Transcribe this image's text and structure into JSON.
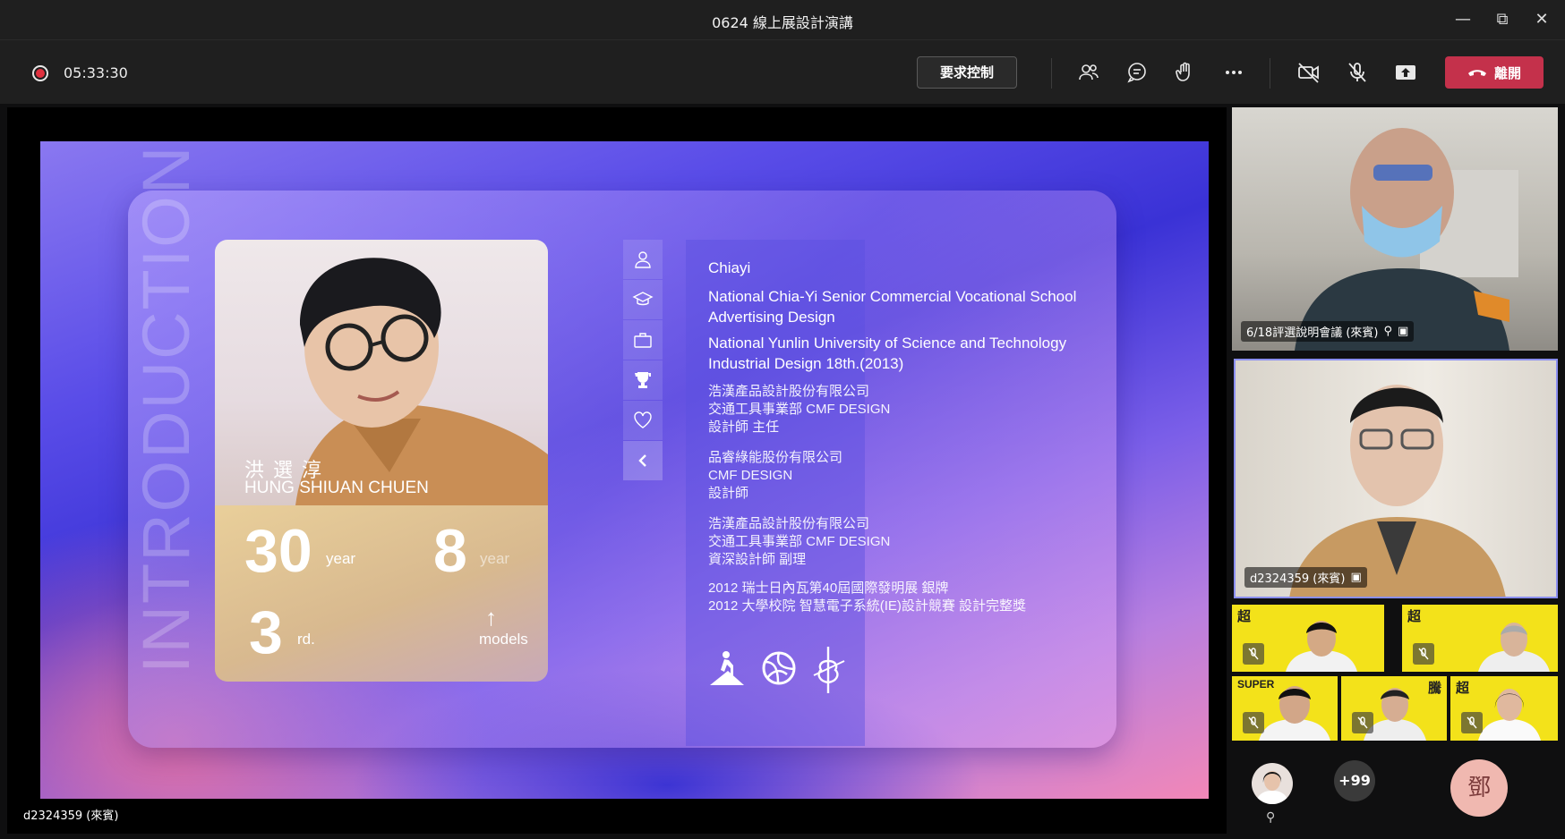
{
  "window": {
    "title": "0624 線上展設計演講"
  },
  "toolbar": {
    "recording_time": "05:33:30",
    "request_control_label": "要求控制",
    "leave_label": "離開"
  },
  "slide": {
    "vertical_title": "INTRODUCTION",
    "name_zh": "洪選淳",
    "name_en": "HUNG SHIUAN CHUEN",
    "stats": [
      {
        "value": "30",
        "unit": "year"
      },
      {
        "value": "8",
        "unit": "year"
      },
      {
        "value": "3",
        "unit": "rd."
      },
      {
        "value": "↑",
        "unit": "models"
      }
    ],
    "info": {
      "city": "Chiayi",
      "school1": "National Chia-Yi Senior Commercial Vocational School",
      "school1_dept": "Advertising Design",
      "school2": "National Yunlin University of Science and Technology",
      "school2_dept": "Industrial Design  18th.(2013)",
      "job1": [
        "浩漢產品設計股份有限公司",
        "交通工具事業部    CMF DESIGN",
        "設計師    主任"
      ],
      "job2": [
        "品睿綠能股份有限公司",
        "CMF DESIGN",
        "設計師"
      ],
      "job3": [
        "浩漢產品設計股份有限公司",
        "交通工具事業部    CMF DESIGN",
        "資深設計師    副理"
      ],
      "awards": [
        "2012  瑞士日內瓦第40屆國際發明展   銀牌",
        "2012  大學校院  智慧電子系統(IE)設計競賽   設計完整獎"
      ]
    }
  },
  "stage": {
    "presenter_label": "d2324359 (來賓)"
  },
  "participants": {
    "tile1_label": "6/18評選說明會議 (來賓)",
    "tile2_label": "d2324359 (來賓)",
    "thumb_logos": [
      "超",
      "超",
      "SUPER",
      "騰",
      "超"
    ],
    "more_count": "+99",
    "initial": "鄧"
  },
  "colors": {
    "leave": "#c4314b",
    "record": "#e0313f",
    "thumb_bg": "#f3e21a"
  }
}
